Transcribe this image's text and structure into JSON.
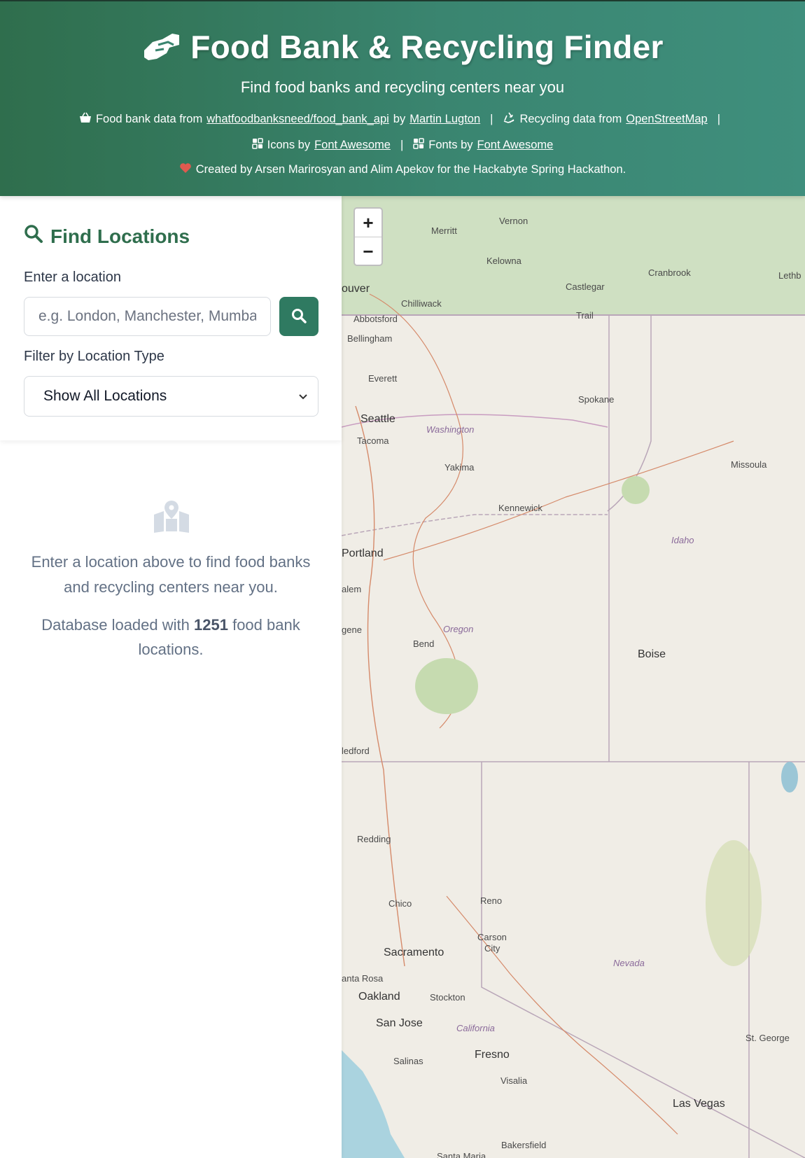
{
  "header": {
    "title": "Food Bank & Recycling Finder",
    "subtitle": "Find food banks and recycling centers near you",
    "credits": {
      "foodbank_prefix": "Food bank data from",
      "foodbank_link": "whatfoodbanksneed/food_bank_api",
      "by": "by",
      "author_link": "Martin Lugton",
      "recycling_prefix": "Recycling data from",
      "recycling_link": "OpenStreetMap",
      "icons_prefix": "Icons by",
      "icons_link": "Font Awesome",
      "fonts_prefix": "Fonts by",
      "fonts_link": "Font Awesome",
      "created_by": "Created by Arsen Marirosyan and Alim Apekov for the Hackabyte Spring Hackathon.",
      "separator": "|"
    },
    "colors": {
      "gradient_start": "#2f6e4d",
      "gradient_end": "#3f8f7d",
      "heart": "#e05a4f"
    }
  },
  "sidebar": {
    "panel_title": "Find Locations",
    "location_label": "Enter a location",
    "location_placeholder": "e.g. London, Manchester, Mumbai",
    "location_value": "",
    "filter_label": "Filter by Location Type",
    "filter_selected": "Show All Locations",
    "empty_message": "Enter a location above to find food banks and recycling centers near you.",
    "db_prefix": "Database loaded with",
    "db_count": "1251",
    "db_suffix": "food bank locations.",
    "accent_color": "#2f7a61"
  },
  "map": {
    "zoom_in": "+",
    "zoom_out": "−",
    "labels": {
      "vernon": "Vernon",
      "merritt": "Merritt",
      "kelowna": "Kelowna",
      "cranbrook": "Cranbrook",
      "lethb": "Lethb",
      "couver": "ouver",
      "castlegar": "Castlegar",
      "chilliwack": "Chilliwack",
      "abbotsford": "Abbotsford",
      "trail": "Trail",
      "bellingham": "Bellingham",
      "everett": "Everett",
      "spokane": "Spokane",
      "seattle": "Seattle",
      "washington": "Washington",
      "tacoma": "Tacoma",
      "missoula": "Missoula",
      "yakima": "Yakima",
      "kennewick": "Kennewick",
      "idaho": "Idaho",
      "portland": "Portland",
      "salem": "alem",
      "oregon": "Oregon",
      "eugene": "gene",
      "bend": "Bend",
      "boise": "Boise",
      "medford": "ledford",
      "redding": "Redding",
      "chico": "Chico",
      "reno": "Reno",
      "carson": "Carson",
      "city": "City",
      "sacramento": "Sacramento",
      "nevada": "Nevada",
      "santarosa": "anta Rosa",
      "oakland": "Oakland",
      "stockton": "Stockton",
      "sanjose": "San Jose",
      "california": "California",
      "stgeorge": "St. George",
      "salinas": "Salinas",
      "fresno": "Fresno",
      "visalia": "Visalia",
      "lasvegas": "Las Vegas",
      "bakersfield": "Bakersfield",
      "santamaria": "Santa Maria"
    }
  }
}
